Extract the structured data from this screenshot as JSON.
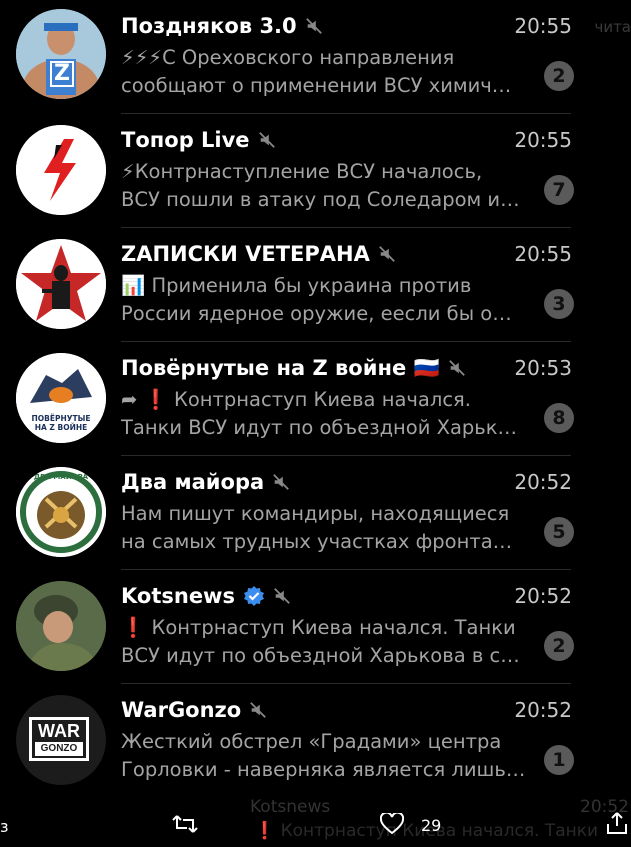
{
  "chats": [
    {
      "name": "Поздняков 3.0",
      "time": "20:55",
      "line1": "⚡⚡⚡С Ореховского направления",
      "line2": "сообщают о применении ВСУ химич…",
      "badge": "2"
    },
    {
      "name": "Топор Live",
      "time": "20:55",
      "line1": "⚡Контрнаступление ВСУ началось,",
      "line2": "ВСУ пошли в атаку под Соледаром и…",
      "badge": "7"
    },
    {
      "name": "ZAПИСКИ VЕТЕРАНА",
      "time": "20:55",
      "line1": "📊 Применила бы украина против",
      "line2": "России ядерное оружие, еесли бы о…",
      "badge": "3"
    },
    {
      "name": "Повёрнутые на Z войне 🇷🇺",
      "time": "20:53",
      "line1": "➦ ❗ Контрнаступ Киева начался.",
      "line2": "Танки ВСУ идут по объездной Харьк…",
      "badge": "8"
    },
    {
      "name": "Два майора",
      "time": "20:52",
      "line1": "Нам пишут командиры, находящиеся",
      "line2": "на самых трудных участках фронта…",
      "badge": "5"
    },
    {
      "name": "Kotsnews",
      "time": "20:52",
      "line1": "❗ Контрнаступ Киева начался. Танки",
      "line2": "ВСУ идут по объездной Харькова в с…",
      "badge": "2"
    },
    {
      "name": "WarGonzo",
      "time": "20:52",
      "line1": "Жесткий обстрел «Градами» центра",
      "line2": "Горловки - наверняка является лишь…",
      "badge": "1"
    }
  ],
  "avatar_text": {
    "poz": "Z",
    "pov_line1": "ПОВЁРНУТЫЕ",
    "pov_line2": "НА Z ВОЙНЕ",
    "dva": "ДВА МАЙОРА",
    "war1": "WAR",
    "war2": "GONZO"
  },
  "bottom_bar": {
    "like_count": "29",
    "left_char": "з"
  },
  "ghost": {
    "right_top": "чита",
    "behind_name": "Kotsnews",
    "behind_time": "20:52",
    "behind_text": "❗ Контрнаступ Киева начался. Танки"
  }
}
